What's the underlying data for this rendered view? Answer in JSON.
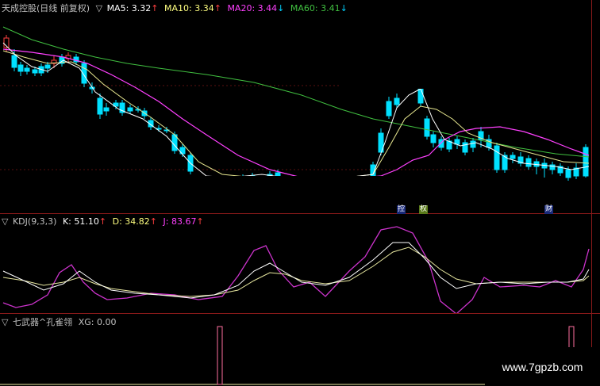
{
  "main_legend": {
    "title": "天成控股(日线 前复权)",
    "indicator_icon": "triangle-down-icon",
    "ma5_label": "MA5: 3.32",
    "ma5_trend": "↑",
    "ma10_label": "MA10: 3.34",
    "ma10_trend": "↑",
    "ma20_label": "MA20: 3.44",
    "ma20_trend": "↓",
    "ma60_label": "MA60: 3.41",
    "ma60_trend": "↓"
  },
  "kdj_legend": {
    "name": "KDJ(9,3,3)",
    "k_label": "K: 51.10",
    "k_trend": "↑",
    "d_label": "D: 34.82",
    "d_trend": "↑",
    "j_label": "J: 83.67",
    "j_trend": "↑"
  },
  "xg_legend": {
    "name": "七武器^孔雀翎",
    "xg_label": "XG: 0.00"
  },
  "tags": {
    "t1": "控",
    "t2": "权",
    "t3": "财"
  },
  "watermark": "www.7gpzb.com",
  "colors": {
    "up": "#ff4040",
    "down": "#00e0ff",
    "ma5": "#ffffff",
    "ma10": "#ffff80",
    "ma20": "#ff40ff",
    "ma60": "#40c040",
    "grid": "#8a1a1a"
  }
}
